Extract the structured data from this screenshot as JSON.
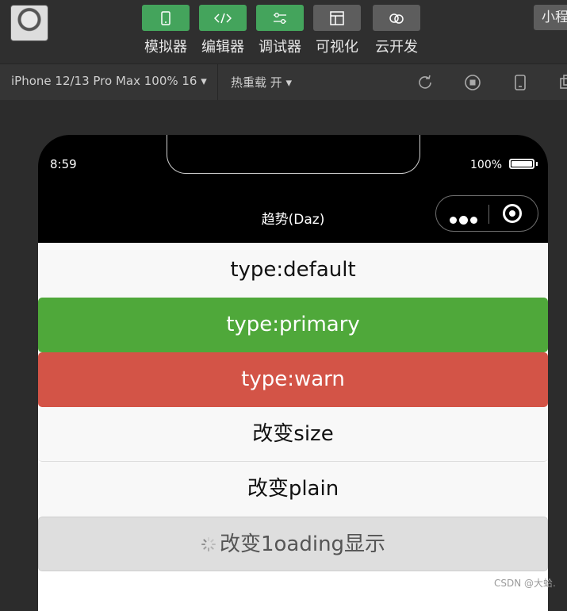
{
  "toolbar": {
    "buttons": [
      {
        "label": "模拟器",
        "icon": "phone-icon",
        "color": "#44a45c"
      },
      {
        "label": "编辑器",
        "icon": "code-icon",
        "color": "#44a45c"
      },
      {
        "label": "调试器",
        "icon": "sliders-icon",
        "color": "#44a45c"
      },
      {
        "label": "可视化",
        "icon": "layout-icon",
        "color": "#5d5d5d"
      },
      {
        "label": "云开发",
        "icon": "cloud-icon",
        "color": "#5d5d5d"
      }
    ],
    "mini_label": "小程"
  },
  "simbar": {
    "device": "iPhone 12/13 Pro Max 100% 16 ▾",
    "hot_reload": "热重载 开 ▾"
  },
  "phone": {
    "time": "8:59",
    "battery": "100%",
    "nav_title": "趋势(Daz)"
  },
  "buttons": [
    {
      "label": "type:default",
      "type": "default"
    },
    {
      "label": "type:primary",
      "type": "primary"
    },
    {
      "label": "type:warn",
      "type": "warn"
    },
    {
      "label": "改变size",
      "type": "default"
    },
    {
      "label": "改变plain",
      "type": "default"
    },
    {
      "label": "改变1oading显示",
      "type": "loading"
    }
  ],
  "watermark": "CSDN @大蛤."
}
